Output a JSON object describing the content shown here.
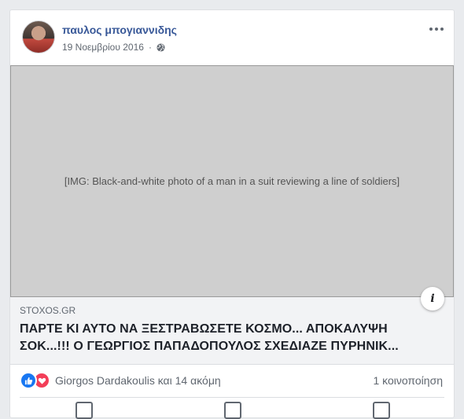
{
  "post": {
    "author": "παυλος μπογιαννιδης",
    "date": "19 Νοεμβρίου 2016",
    "privacy_icon": "globe-icon",
    "more_icon": "more-options-icon"
  },
  "link": {
    "domain": "STOXOS.GR",
    "headline": "ΠΑΡΤΕ ΚΙ ΑΥΤΟ ΝΑ ΞΕΣΤΡΑΒΩΣΕΤΕ ΚΟΣΜΟ... ΑΠΟΚΑΛΥΨΗ\nΣΟΚ...!!! Ο ΓΕΩΡΓΙΟΣ ΠΑΠΑΔΟΠΟΥΛΟΣ ΣΧΕΔΙΑΖΕ ΠΥΡΗΝΙΚ...",
    "info_icon": "info-icon",
    "info_label": "i"
  },
  "reactions": {
    "icons": [
      "like-icon",
      "love-icon"
    ],
    "summary": "Giorgos Dardakoulis και 14 ακόμη",
    "shares": "1 κοινοποίηση"
  },
  "colors": {
    "author": "#385898",
    "like": "#1877f2",
    "love": "#f33e58",
    "secondary_text": "#606770"
  }
}
